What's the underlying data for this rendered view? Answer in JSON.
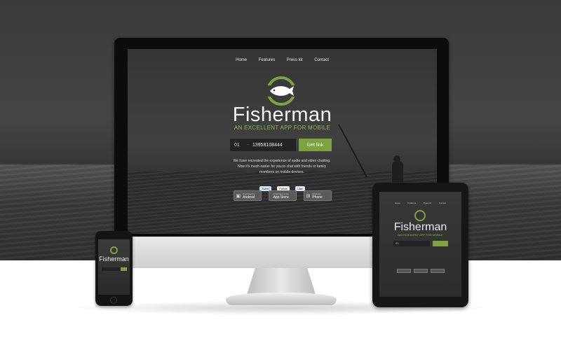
{
  "brand": {
    "name": "Fisherman",
    "tagline": "AN EXCELLENT APP FOR MOBILE",
    "accent": "#7da33f"
  },
  "nav": {
    "items": [
      "Home",
      "Features",
      "Press kit",
      "Contact"
    ]
  },
  "form": {
    "country_code": "01",
    "phone_number": "13958108444",
    "submit_label": "Get link"
  },
  "description": "We have recreated the experience of audio and video chatting. Now it's much easier for you to chat with friends or family members on mobile devices.",
  "social": {
    "tweet": "Tweet",
    "follow": "Follow",
    "like": "Like"
  },
  "stores": [
    {
      "small": "Download for",
      "big": "Android",
      "icon": "android-icon"
    },
    {
      "small": "Download on the",
      "big": "App Store",
      "icon": "apple-icon"
    },
    {
      "small": "Windows",
      "big": "Phone",
      "icon": "windows-icon"
    }
  ]
}
